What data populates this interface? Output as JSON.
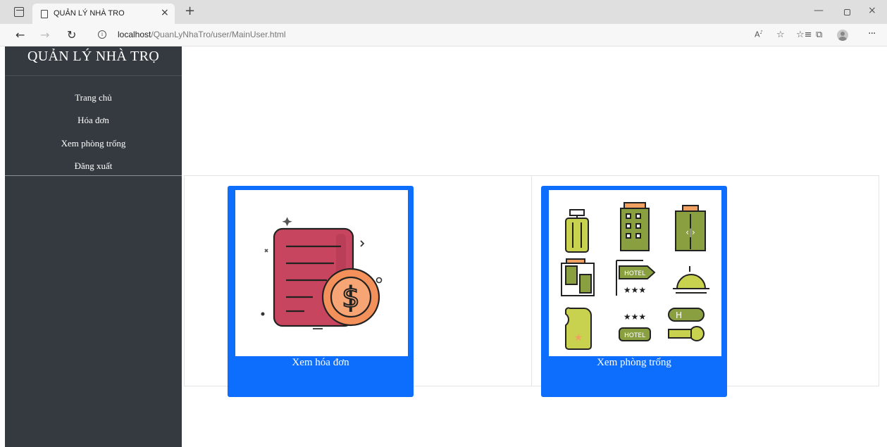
{
  "browser": {
    "tab_title": "QUẢN LÝ NHÀ TRO",
    "url_host": "localhost",
    "url_path": "/QuanLyNhaTro/user/MainUser.html",
    "new_tab_glyph": "+",
    "close_glyph": "×",
    "icons": [
      "tab-actions-icon",
      "page-icon",
      "back-icon",
      "forward-icon",
      "reload-icon",
      "info-icon",
      "read-aloud-icon",
      "favorite-icon",
      "favorites-icon",
      "collections-icon",
      "profile-icon",
      "more-icon"
    ]
  },
  "sidebar": {
    "brand": "QUẢN LÝ NHÀ TRỌ",
    "menu": [
      {
        "label": "Trang chủ"
      },
      {
        "label": "Hóa đơn"
      },
      {
        "label": "Xem phòng trống"
      },
      {
        "label": "Đăng xuất"
      }
    ]
  },
  "cards": [
    {
      "label": "Xem hóa đơn",
      "image": "invoice-dollar-illustration"
    },
    {
      "label": "Xem phòng trống",
      "image": "hotel-icons-grid"
    }
  ],
  "colors": {
    "sidebar_bg": "#343a40",
    "card_bg": "#0d6efd"
  }
}
